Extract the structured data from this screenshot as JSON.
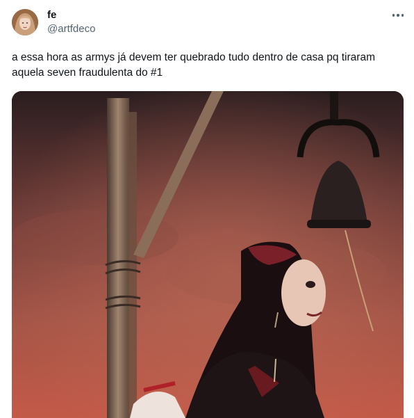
{
  "post": {
    "author_name": "fe",
    "author_handle": "@artfdeco",
    "text": "a essa hora as armys já devem ter quebrado tudo dentro de casa pq tiraram aquela seven fraudulenta do #1",
    "more_icon": "more-horizontal-icon",
    "avatar_icon": "profile-avatar"
  },
  "colors": {
    "text_primary": "#0f1419",
    "text_secondary": "#536471",
    "background": "#ffffff"
  }
}
